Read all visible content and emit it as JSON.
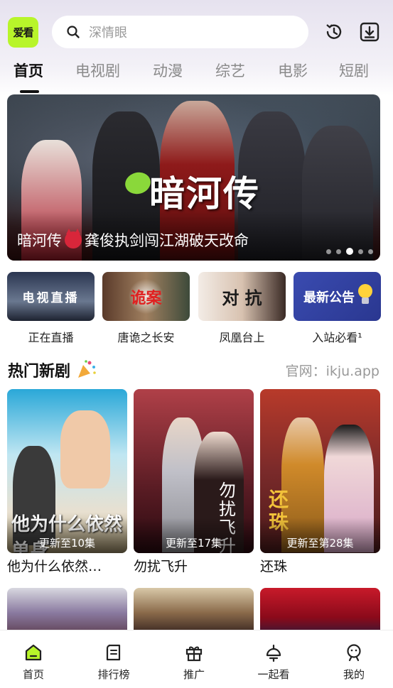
{
  "header": {
    "logo_text": "爱看",
    "search_placeholder": "深情眼",
    "history_icon": "history-icon",
    "download_icon": "download-icon",
    "logo_color": "#b8f52a"
  },
  "tabs": [
    {
      "label": "首页",
      "active": true
    },
    {
      "label": "电视剧"
    },
    {
      "label": "动漫"
    },
    {
      "label": "综艺"
    },
    {
      "label": "电影"
    },
    {
      "label": "短剧"
    }
  ],
  "banner": {
    "caption_prefix": "暗河传",
    "caption_suffix": "龚俊执剑闯江湖破天改命",
    "art_title": "暗河传",
    "page_count": 5,
    "active_page": 3
  },
  "quick_entries": [
    {
      "label": "正在直播",
      "art": "电视直播"
    },
    {
      "label": "唐诡之长安",
      "art": "诡案"
    },
    {
      "label": "凤凰台上",
      "art": "对  抗"
    },
    {
      "label": "入站必看¹",
      "art": "最新公告"
    }
  ],
  "section": {
    "title": "热门新剧",
    "link": "官网：ikju.app"
  },
  "dramas": [
    {
      "name": "他为什么依然…",
      "update": "更新至10集",
      "art": "他为什么依然单身"
    },
    {
      "name": "勿扰飞升",
      "update": "更新至17集",
      "art": "勿扰飞升"
    },
    {
      "name": "还珠",
      "update": "更新至第28集",
      "art": "还珠"
    }
  ],
  "bottom_nav": [
    {
      "label": "首页",
      "icon": "home-icon",
      "active": true
    },
    {
      "label": "排行榜",
      "icon": "ranking-icon"
    },
    {
      "label": "推广",
      "icon": "gift-icon"
    },
    {
      "label": "一起看",
      "icon": "watch-together-icon"
    },
    {
      "label": "我的",
      "icon": "profile-icon"
    }
  ]
}
